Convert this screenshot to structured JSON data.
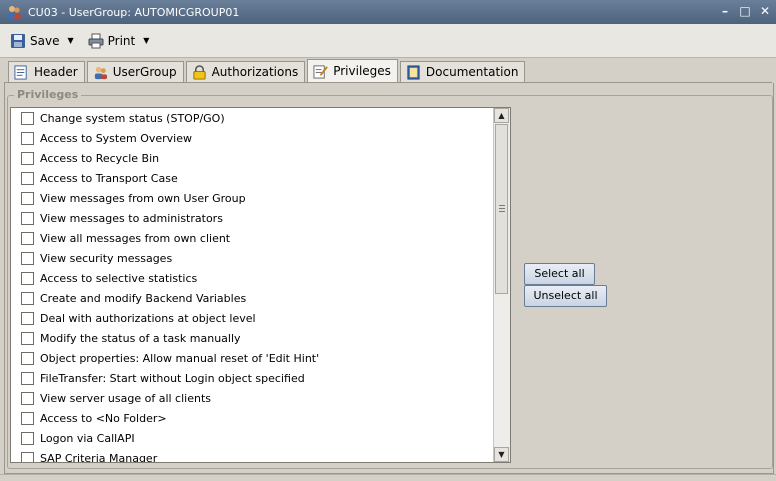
{
  "window": {
    "title": "CU03 - UserGroup: AUTOMICGROUP01",
    "controls": [
      "minimize-icon",
      "maximize-icon",
      "close-icon"
    ]
  },
  "toolbar": {
    "save_label": "Save",
    "print_label": "Print"
  },
  "tabs": [
    {
      "label": "Header",
      "icon": "header-icon",
      "active": false
    },
    {
      "label": "UserGroup",
      "icon": "usergroup-icon",
      "active": false
    },
    {
      "label": "Authorizations",
      "icon": "lock-icon",
      "active": false
    },
    {
      "label": "Privileges",
      "icon": "privileges-icon",
      "active": true
    },
    {
      "label": "Documentation",
      "icon": "book-icon",
      "active": false
    }
  ],
  "privileges": {
    "group_label": "Privileges",
    "items": [
      {
        "label": "Change system status (STOP/GO)",
        "checked": false
      },
      {
        "label": "Access to System Overview",
        "checked": false
      },
      {
        "label": "Access to Recycle Bin",
        "checked": false
      },
      {
        "label": "Access to Transport Case",
        "checked": false
      },
      {
        "label": "View messages from own User Group",
        "checked": false
      },
      {
        "label": "View messages to administrators",
        "checked": false
      },
      {
        "label": "View all messages from own client",
        "checked": false
      },
      {
        "label": "View security messages",
        "checked": false
      },
      {
        "label": "Access to selective statistics",
        "checked": false
      },
      {
        "label": "Create and modify Backend Variables",
        "checked": false
      },
      {
        "label": "Deal with authorizations at object level",
        "checked": false
      },
      {
        "label": "Modify the status of a task manually",
        "checked": false
      },
      {
        "label": "Object properties: Allow manual reset of 'Edit Hint'",
        "checked": false
      },
      {
        "label": "FileTransfer: Start without Login object specified",
        "checked": false
      },
      {
        "label": "View server usage of all clients",
        "checked": false
      },
      {
        "label": "Access to <No Folder>",
        "checked": false
      },
      {
        "label": "Logon via CallAPI",
        "checked": false
      },
      {
        "label": "SAP Criteria Manager",
        "checked": false
      }
    ],
    "select_all_label": "Select all",
    "unselect_all_label": "Unselect all"
  }
}
